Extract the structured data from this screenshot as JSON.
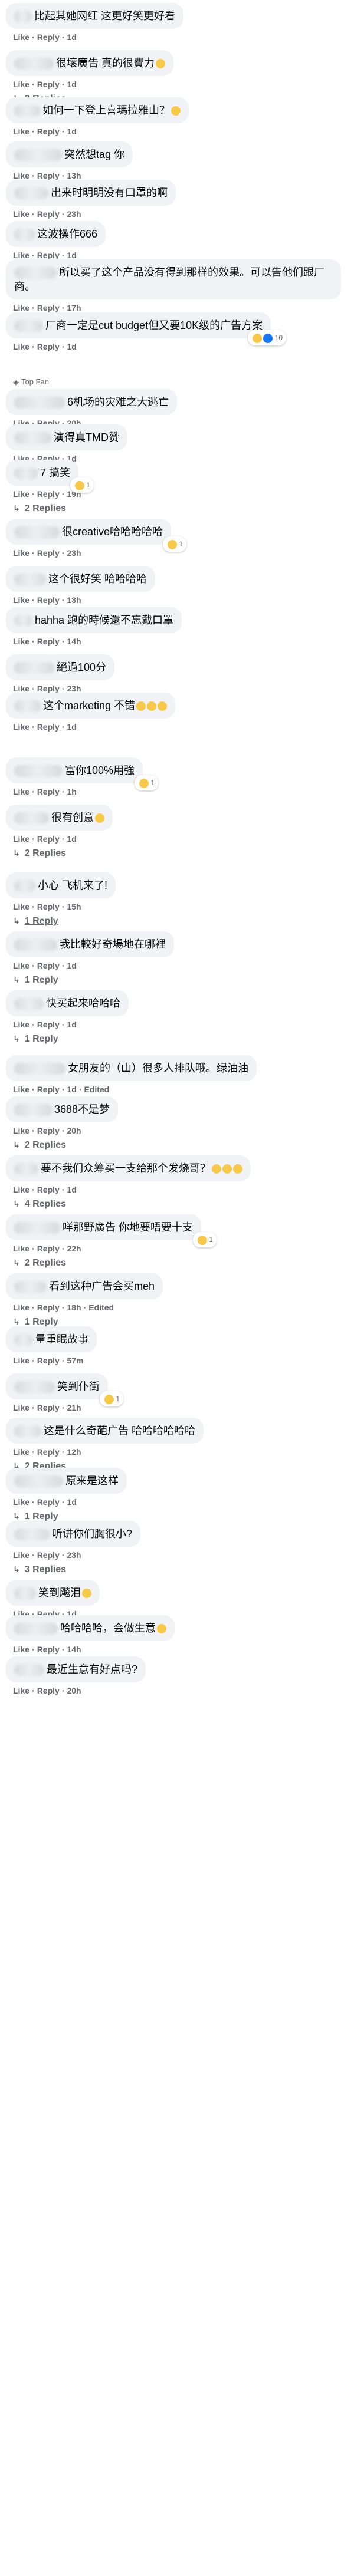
{
  "labels": {
    "like": "Like",
    "reply": "Reply",
    "dot": "·",
    "edited": "Edited",
    "top_fan": "Top Fan"
  },
  "comments": [
    {
      "text": "比起其她网红 这更好笑更好看",
      "time": "1d",
      "replies": ""
    },
    {
      "text": "很壞廣告 真的很費力",
      "time": "1d",
      "replies": "2 Replies",
      "emoji": "1"
    },
    {
      "text": "如何一下登上喜瑪拉雅山？",
      "time": "1d",
      "replies": "",
      "emoji": "1"
    },
    {
      "text": "突然想tag 你",
      "time": "13h",
      "replies": ""
    },
    {
      "text": "出来时明明没有口罩的啊",
      "time": "23h",
      "replies": ""
    },
    {
      "text": "这波操作666",
      "time": "1d",
      "replies": ""
    },
    {
      "text": "所以买了这个产品没有得到那样的效果。可以告他们跟厂商。",
      "time": "17h",
      "replies": ""
    },
    {
      "text": "厂商一定是cut budget但又要10K级的广告方案",
      "time": "1d",
      "replies": "",
      "react": "10"
    },
    {
      "text": "6机场的灾难之大逃亡",
      "time": "20h",
      "replies": "",
      "top_fan": true
    },
    {
      "text": "演得真TMD赞",
      "time": "1d",
      "replies": ""
    },
    {
      "text": "7 搞笑",
      "time": "19h",
      "replies": "2 Replies",
      "react": "1"
    },
    {
      "text": "很creative哈哈哈哈哈",
      "time": "23h",
      "replies": "",
      "react": "1"
    },
    {
      "text": "这个很好笑 哈哈哈哈",
      "time": "13h",
      "replies": ""
    },
    {
      "text": "hahha 跑的時候還不忘戴口罩",
      "time": "14h",
      "replies": ""
    },
    {
      "text": "絕過100分",
      "time": "23h",
      "replies": ""
    },
    {
      "text": "这个marketing 不错",
      "time": "1d",
      "replies": "",
      "emoji": "3"
    },
    {
      "text": "富你100%用強",
      "time": "1h",
      "replies": "",
      "react": "1"
    },
    {
      "text": "很有创意",
      "time": "1d",
      "replies": "2 Replies",
      "emoji": "1"
    },
    {
      "text": "小心 飞机来了!",
      "time": "15h",
      "replies": "1 Reply",
      "underline": true
    },
    {
      "text": "我比較好奇場地在哪裡",
      "time": "1d",
      "replies": "1 Reply"
    },
    {
      "text": "快买起来哈哈哈",
      "time": "1d",
      "replies": "1 Reply"
    },
    {
      "text": "女朋友的（山）很多人排队哦。绿油油",
      "time": "1d",
      "replies": "",
      "edited": true
    },
    {
      "text": "3688不是梦",
      "time": "20h",
      "replies": "2 Replies"
    },
    {
      "text": "要不我们众筹买一支给那个发烧哥？",
      "time": "1d",
      "replies": "4 Replies",
      "emoji": "3"
    },
    {
      "text": "咩那野廣告 你地要唔要十支",
      "time": "22h",
      "replies": "2 Replies",
      "react": "1"
    },
    {
      "text": "看到这种广告会买meh",
      "time": "18h",
      "replies": "1 Reply",
      "edited": true
    },
    {
      "text": "量重眠故事",
      "time": "57m",
      "replies": ""
    },
    {
      "text": "笑到仆街",
      "time": "21h",
      "replies": "",
      "react": "1"
    },
    {
      "text": "这是什么奇葩广告 哈哈哈哈哈哈",
      "time": "12h",
      "replies": "2 Replies"
    },
    {
      "text": "原来是这样",
      "time": "1d",
      "replies": "1 Reply"
    },
    {
      "text": "听讲你们胸很小?",
      "time": "23h",
      "replies": "3 Replies"
    },
    {
      "text": "笑到飚泪",
      "time": "1d",
      "replies": "",
      "emoji": "1"
    },
    {
      "text": "哈哈哈哈，会做生意",
      "time": "14h",
      "replies": "",
      "emoji": "1"
    },
    {
      "text": "最近生意有好点吗?",
      "time": "20h",
      "replies": ""
    }
  ]
}
